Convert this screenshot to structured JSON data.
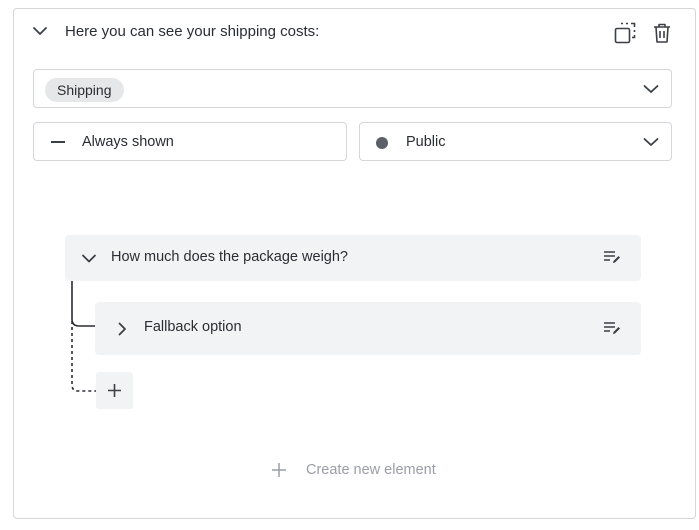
{
  "header": {
    "title": "Here you can see your shipping costs:"
  },
  "selects": {
    "category_tag": "Shipping",
    "display_mode": "Always shown",
    "visibility": "Public"
  },
  "tree": {
    "question_label": "How much does the package weigh?",
    "fallback_label": "Fallback option"
  },
  "footer": {
    "create_label": "Create new element"
  },
  "colors": {
    "border": "#d4d6da",
    "row_bg": "#f2f3f4",
    "tag_bg": "#e6e7e9",
    "text": "#2a2d33",
    "muted": "#9a9ea5"
  }
}
